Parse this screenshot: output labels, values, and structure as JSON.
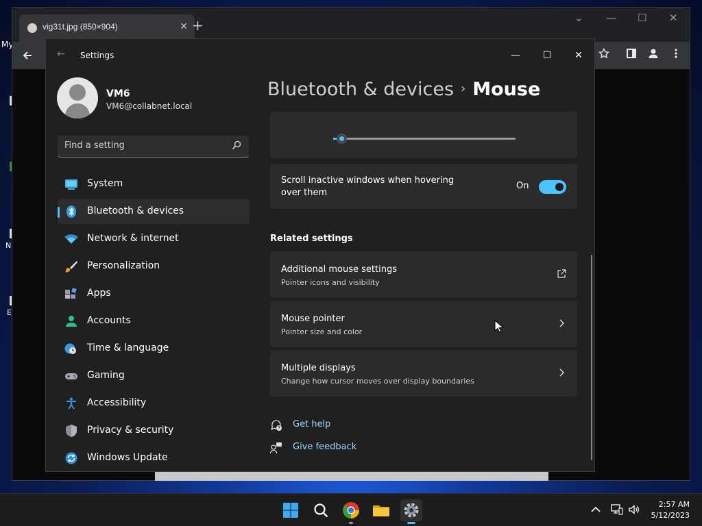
{
  "desktop": {
    "label_fragments": [
      "My",
      "N",
      "E"
    ]
  },
  "browser": {
    "tab_title": "vig31t.jpg (850×904)",
    "tab_close": "✕",
    "new_tab": "+",
    "controls": [
      "⌄",
      "—",
      "☐",
      "✕"
    ]
  },
  "settings": {
    "window_title": "Settings",
    "back_glyph": "←",
    "controls": {
      "minimize": "—",
      "maximize": "☐",
      "close": "✕"
    },
    "user": {
      "name": "VM6",
      "email": "VM6@collabnet.local"
    },
    "search": {
      "placeholder": "Find a setting"
    },
    "nav": [
      {
        "label": "System",
        "icon": "system-icon",
        "active": false
      },
      {
        "label": "Bluetooth & devices",
        "icon": "bluetooth-icon",
        "active": true
      },
      {
        "label": "Network & internet",
        "icon": "wifi-icon",
        "active": false
      },
      {
        "label": "Personalization",
        "icon": "paintbrush-icon",
        "active": false
      },
      {
        "label": "Apps",
        "icon": "apps-icon",
        "active": false
      },
      {
        "label": "Accounts",
        "icon": "accounts-icon",
        "active": false
      },
      {
        "label": "Time & language",
        "icon": "clock-globe-icon",
        "active": false
      },
      {
        "label": "Gaming",
        "icon": "gamepad-icon",
        "active": false
      },
      {
        "label": "Accessibility",
        "icon": "accessibility-icon",
        "active": false
      },
      {
        "label": "Privacy & security",
        "icon": "shield-icon",
        "active": false
      },
      {
        "label": "Windows Update",
        "icon": "update-icon",
        "active": false
      }
    ],
    "breadcrumb": {
      "parent": "Bluetooth & devices",
      "separator": "›",
      "current": "Mouse"
    },
    "slider": {
      "value_fraction": 0.05
    },
    "scroll_inactive": {
      "label": "Scroll inactive windows when hovering over them",
      "state": "On"
    },
    "related": {
      "title": "Related settings",
      "items": [
        {
          "title": "Additional mouse settings",
          "subtitle": "Pointer icons and visibility",
          "icon": "external-link-icon"
        },
        {
          "title": "Mouse pointer",
          "subtitle": "Pointer size and color",
          "icon": "chevron-right-icon"
        },
        {
          "title": "Multiple displays",
          "subtitle": "Change how cursor moves over display boundaries",
          "icon": "chevron-right-icon"
        }
      ]
    },
    "help": {
      "get_help": "Get help",
      "give_feedback": "Give feedback"
    }
  },
  "taskbar": {
    "time": "2:57 AM",
    "date": "5/12/2023"
  },
  "colors": {
    "accent": "#4cc2ff",
    "window_bg": "#202020",
    "card_bg": "#2b2b2b",
    "link": "#9ad7ff"
  }
}
